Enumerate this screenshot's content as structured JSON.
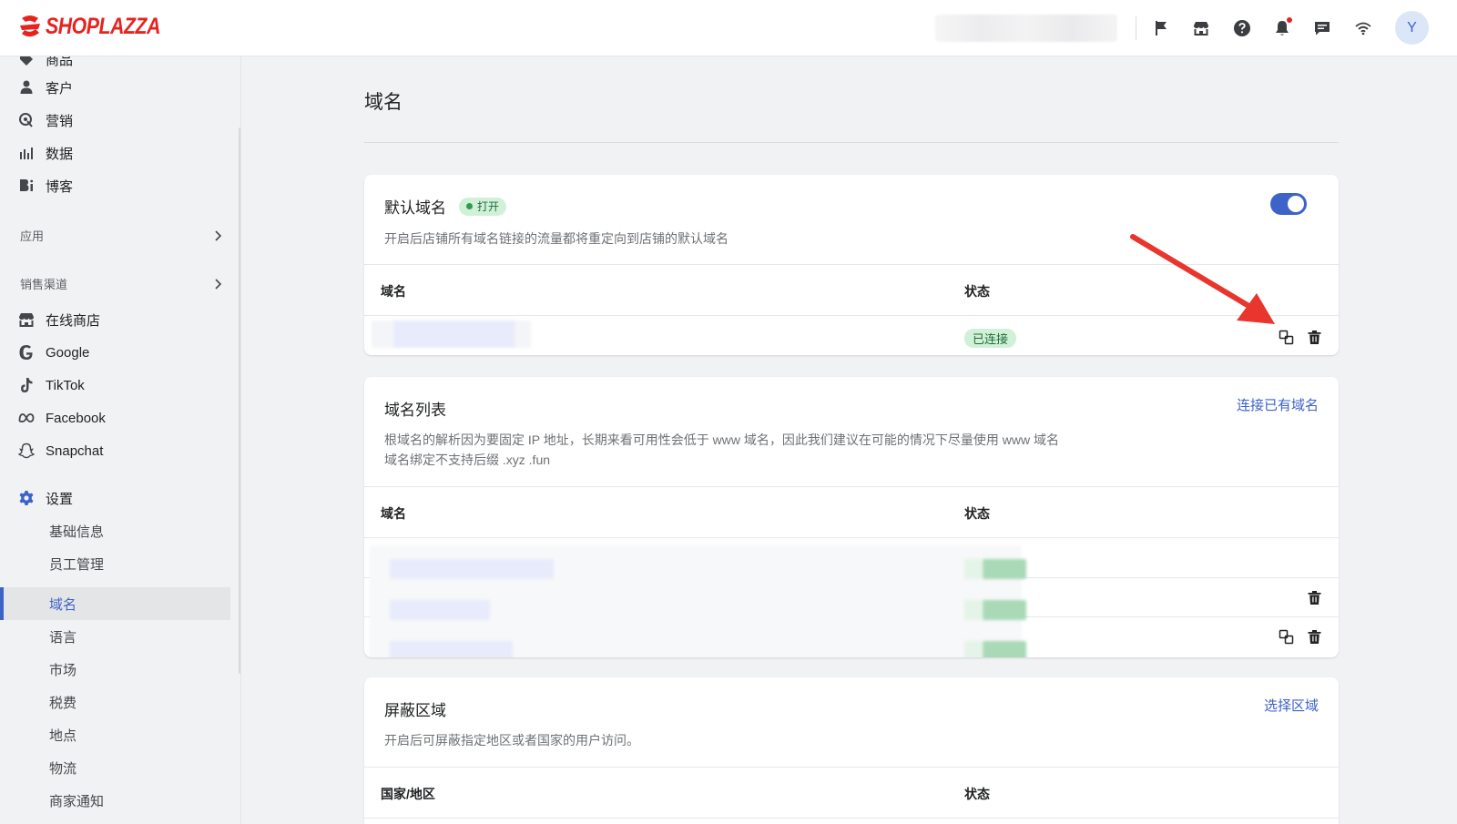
{
  "brand": {
    "name": "SHOPLAZZA",
    "color": "#e8231f",
    "accent": "#3d62c8"
  },
  "header": {
    "icons": [
      "flag-icon",
      "store-icon",
      "help-icon",
      "bell-icon",
      "chat-icon",
      "wifi-icon"
    ],
    "avatar_initial": "Y"
  },
  "sidebar": {
    "top_items": [
      {
        "label": "商品",
        "icon": "tag-icon"
      },
      {
        "label": "客户",
        "icon": "user-icon"
      },
      {
        "label": "营销",
        "icon": "marketing-icon"
      },
      {
        "label": "数据",
        "icon": "bar-chart-icon"
      },
      {
        "label": "博客",
        "icon": "blog-icon"
      }
    ],
    "apps_label": "应用",
    "channels_label": "销售渠道",
    "channels": [
      {
        "label": "在线商店",
        "icon": "store-icon"
      },
      {
        "label": "Google",
        "icon": "google-icon"
      },
      {
        "label": "TikTok",
        "icon": "tiktok-icon"
      },
      {
        "label": "Facebook",
        "icon": "meta-icon"
      },
      {
        "label": "Snapchat",
        "icon": "snapchat-icon"
      }
    ],
    "settings_label": "设置",
    "settings_items": [
      "基础信息",
      "员工管理",
      "域名",
      "语言",
      "市场",
      "税费",
      "地点",
      "物流",
      "商家通知"
    ],
    "active_item": "域名"
  },
  "main": {
    "page_title": "域名",
    "default_domain": {
      "title": "默认域名",
      "badge": "打开",
      "toggle_on": true,
      "description": "开启后店铺所有域名链接的流量都将重定向到店铺的默认域名",
      "col_domain": "域名",
      "col_status": "状态",
      "row_status": "已连接"
    },
    "domain_list": {
      "title": "域名列表",
      "link": "连接已有域名",
      "desc_line1": "根域名的解析因为要固定 IP 地址，长期来看可用性会低于 www 域名，因此我们建议在可能的情况下尽量使用 www 域名",
      "desc_line2": "域名绑定不支持后缀 .xyz .fun",
      "col_domain": "域名",
      "col_status": "状态"
    },
    "blocked_regions": {
      "title": "屏蔽区域",
      "link": "选择区域",
      "description": "开启后可屏蔽指定地区或者国家的用户访问。",
      "col_region": "国家/地区",
      "col_status": "状态"
    }
  }
}
